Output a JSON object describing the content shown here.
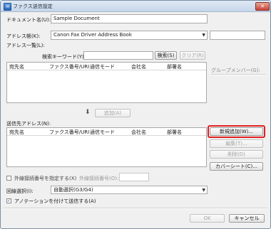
{
  "window": {
    "title": "ファクス送信設定",
    "close_label": "✕"
  },
  "document_name": {
    "label": "ドキュメント名(U):",
    "value": "Sample Document"
  },
  "address_book": {
    "label": "アドレス帳(K):",
    "selected": "Canon Fax Driver Address Book"
  },
  "address_list": {
    "label": "アドレス一覧(L):",
    "search_label": "検索キーワード(Y):",
    "search_value": "",
    "search_button": "検索(S)",
    "clear_button": "クリア(R)",
    "columns": [
      "宛先名",
      "ファクス番号/URI",
      "通信モード",
      "会社名",
      "部署名"
    ]
  },
  "group_members_label": "グループメンバー(G):",
  "add_button": "追加(A)",
  "recipients": {
    "label": "送信先アドレス(N):",
    "columns": [
      "宛先名",
      "ファクス番号/URI",
      "通信モード",
      "会社名",
      "部署名"
    ]
  },
  "buttons": {
    "new_add": "新規追加(W)...",
    "edit": "編集(T)...",
    "delete": "削除(D)",
    "cover_sheet": "カバーシート(C)...",
    "ok": "OK",
    "cancel": "キャンセル"
  },
  "outside_line": {
    "label": "外線接続番号を指定する(X)",
    "number_label": "外線接続番号(O):",
    "number_value": ""
  },
  "line_select": {
    "label": "回線選択(I):",
    "selected": "自動選択(G3/G4)"
  },
  "annotation": {
    "label": "アノテーションを付けて送信する(A)",
    "checked": true
  }
}
